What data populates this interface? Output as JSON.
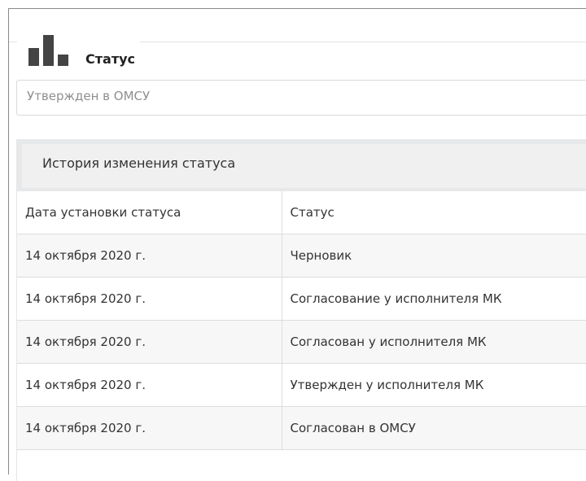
{
  "status_section": {
    "title": "Статус",
    "icon": "bar-chart-icon",
    "current_status_value": "Утвержден в ОМСУ"
  },
  "history": {
    "title": "История изменения статуса",
    "columns": [
      "Дата установки статуса",
      "Статус"
    ],
    "rows": [
      {
        "date": "14 октября 2020 г.",
        "status": "Черновик"
      },
      {
        "date": "14 октября 2020 г.",
        "status": "Согласование у исполнителя МК"
      },
      {
        "date": "14 октября 2020 г.",
        "status": "Согласован у исполнителя МК"
      },
      {
        "date": "14 октября 2020 г.",
        "status": "Утвержден у исполнителя МК"
      },
      {
        "date": "14 октября 2020 г.",
        "status": "Согласован в ОМСУ"
      }
    ]
  },
  "colors": {
    "icon": "#444444",
    "header_background": "#f0f0f0",
    "row_striped": "#f7f7f7",
    "placeholder_text": "#8f8f8f"
  }
}
